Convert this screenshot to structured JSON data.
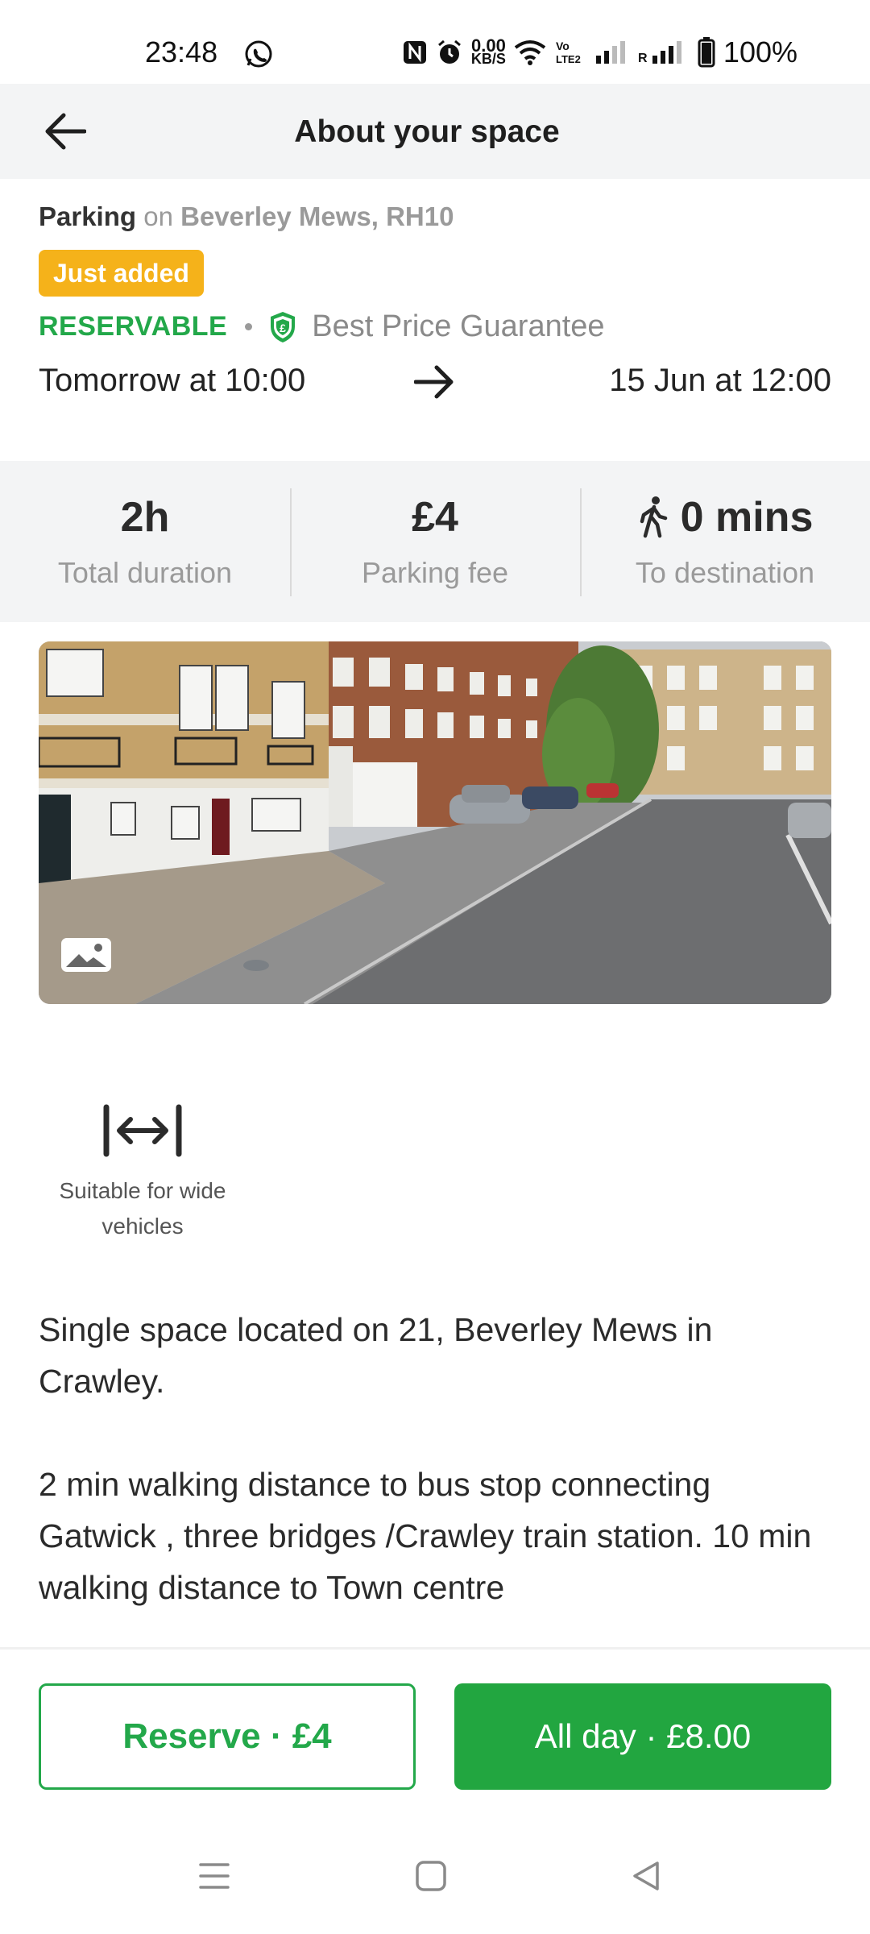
{
  "status_bar": {
    "time": "23:48",
    "speed_value": "0.00",
    "speed_unit": "KB/S",
    "battery": "100%"
  },
  "app_bar": {
    "title": "About your space"
  },
  "header": {
    "type": "Parking",
    "on": "on",
    "location": "Beverley Mews, RH10",
    "badge": "Just added",
    "reservable": "RESERVABLE",
    "guarantee": "Best Price Guarantee",
    "date_from": "Tomorrow at 10:00",
    "date_to": "15 Jun at 12:00"
  },
  "stats": [
    {
      "value": "2h",
      "label": "Total duration"
    },
    {
      "value": "£4",
      "label": "Parking fee"
    },
    {
      "value": "0 mins",
      "label": "To destination"
    }
  ],
  "feature": {
    "label": "Suitable for wide vehicles"
  },
  "description": {
    "paragraph1": "Single space located on 21, Beverley Mews in Crawley.",
    "paragraph2": "2 min walking distance  to bus stop connecting Gatwick , three bridges /Crawley train station. 10 min walking distance to Town centre"
  },
  "actions": {
    "reserve": "Reserve · £4",
    "all_day": "All day · £8.00"
  },
  "colors": {
    "brand_green": "#23a84a",
    "badge_yellow": "#f5b21a",
    "panel_gray": "#f3f4f5"
  }
}
